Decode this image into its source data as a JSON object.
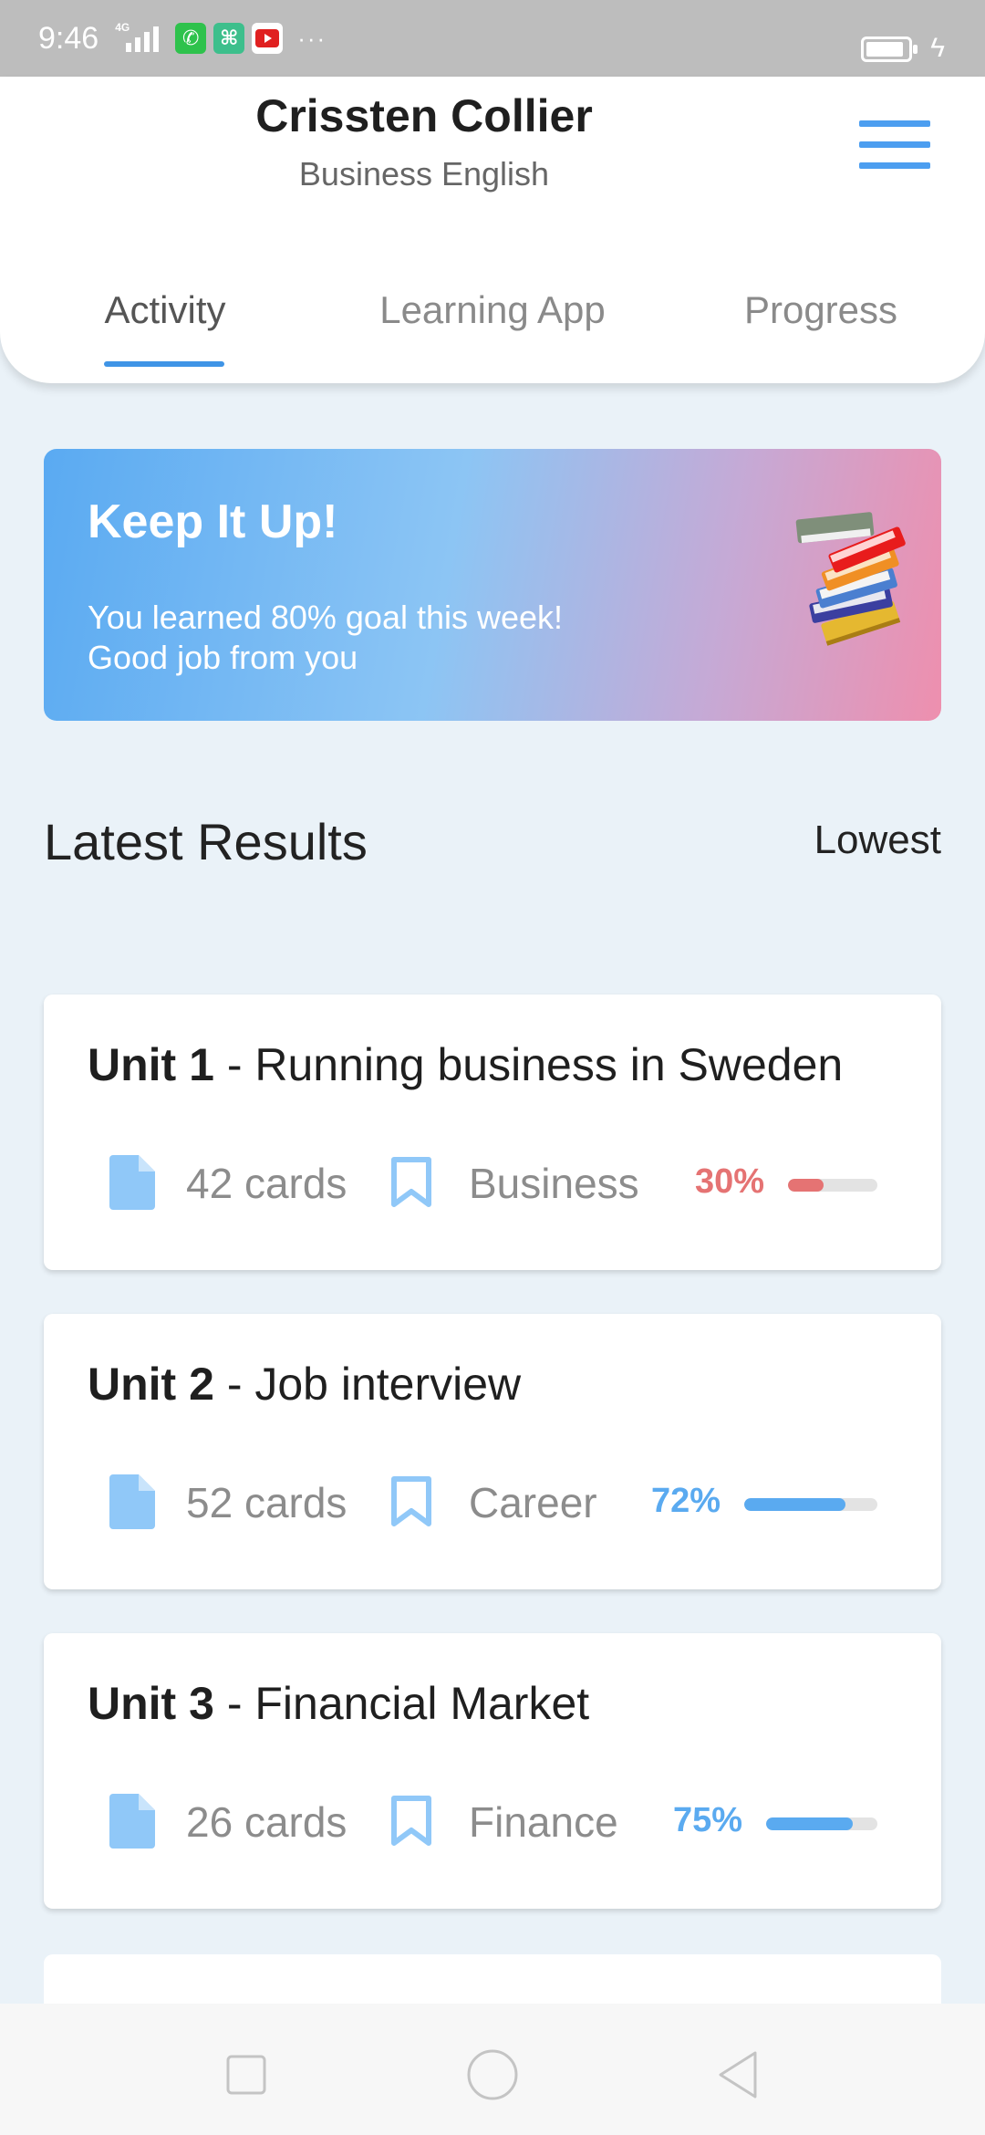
{
  "status_bar": {
    "time": "9:46",
    "network": "4G",
    "more": "···"
  },
  "header": {
    "name": "Crissten Collier",
    "course": "Business English",
    "tabs": [
      {
        "label": "Activity",
        "active": true
      },
      {
        "label": "Learning App",
        "active": false
      },
      {
        "label": "Progress",
        "active": false
      }
    ]
  },
  "banner": {
    "title": "Keep It Up!",
    "line1": "You learned 80% goal this week!",
    "line2": "Good job from you",
    "gradient": [
      "#5aaaf2",
      "#8cc5f4",
      "#c6a9d5",
      "#ee8fae"
    ]
  },
  "results": {
    "title": "Latest Results",
    "sort_label": "Lowest"
  },
  "units": [
    {
      "unit": "Unit 1",
      "name": "- Running business in Sweden",
      "cards": "42 cards",
      "category": "Business",
      "percent": "30%",
      "progress": 0.3,
      "color": "#e57373"
    },
    {
      "unit": "Unit 2",
      "name": "- Job interview",
      "cards": "52 cards",
      "category": "Career",
      "percent": "72%",
      "progress": 0.72,
      "color": "#5aaaf0"
    },
    {
      "unit": "Unit 3",
      "name": "- Financial Market",
      "cards": "26 cards",
      "category": "Finance",
      "percent": "75%",
      "progress": 0.75,
      "color": "#5aaaf0"
    }
  ],
  "colors": {
    "accent": "#3f94e6",
    "icon_blue": "#90c8f8",
    "background": "#eaf2f8"
  },
  "icons": {
    "menu": "hamburger-menu-icon",
    "books": "stack-of-books-icon",
    "cards": "document-icon",
    "category": "bookmark-icon"
  }
}
